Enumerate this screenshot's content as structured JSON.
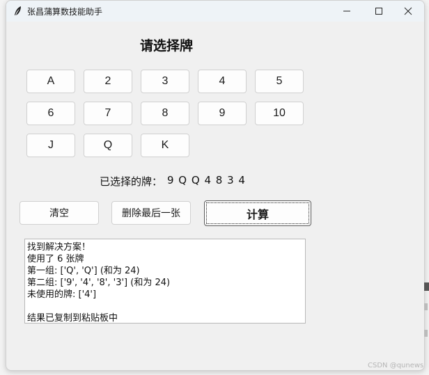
{
  "window": {
    "title": "张昌蒲算数技能助手",
    "controls": [
      "minimize",
      "maximize",
      "close"
    ]
  },
  "heading": "请选择牌",
  "cards": [
    [
      "A",
      "2",
      "3",
      "4",
      "5"
    ],
    [
      "6",
      "7",
      "8",
      "9",
      "10"
    ],
    [
      "J",
      "Q",
      "K"
    ]
  ],
  "selected": {
    "label": "已选择的牌：",
    "value": "9 Q Q 4 8 3 4"
  },
  "actions": {
    "clear": "清空",
    "delete_last": "删除最后一张",
    "compute": "计算"
  },
  "result_lines": [
    "找到解决方案！",
    "使用了 6 张牌",
    "第一组: ['Q', 'Q'] (和为 24)",
    "第二组: ['9', '4', '8', '3'] (和为 24)",
    "未使用的牌: ['4']",
    "",
    "结果已复制到粘贴板中"
  ],
  "watermark": "CSDN @qunews"
}
